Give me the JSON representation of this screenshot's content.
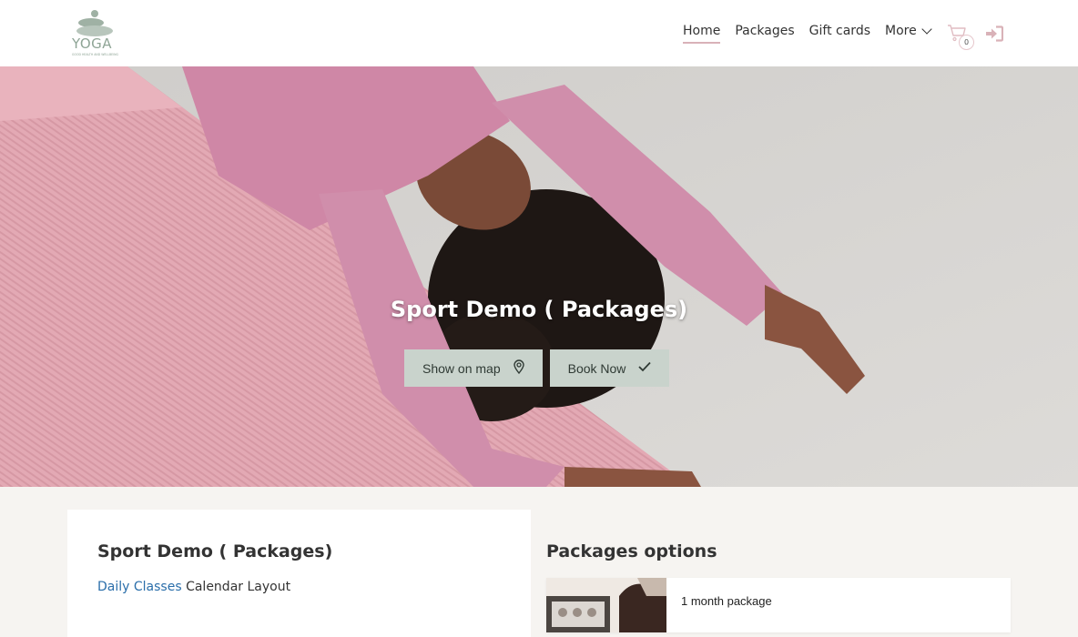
{
  "header": {
    "logo_text": "YOGA",
    "logo_tagline": "GOOD HEALTH AND WELLBEING",
    "nav": [
      {
        "label": "Home",
        "active": true
      },
      {
        "label": "Packages",
        "active": false
      },
      {
        "label": "Gift cards",
        "active": false
      },
      {
        "label": "More",
        "active": false
      }
    ],
    "cart_count": "0",
    "cart_icon": "cart-icon",
    "login_icon": "sign-in-icon"
  },
  "hero": {
    "title": "Sport Demo ( Packages)",
    "show_on_map_label": "Show on map",
    "show_on_map_icon": "map-marker-icon",
    "book_now_label": "Book Now",
    "book_now_icon": "check-icon"
  },
  "info_card": {
    "title": "Sport Demo ( Packages)",
    "link_text": "Daily Classes",
    "line_text": "Calendar Layout"
  },
  "packages": {
    "title": "Packages options",
    "items": [
      {
        "name": "1 month package"
      }
    ]
  },
  "colors": {
    "accent_pink": "#d9b2b8",
    "button_sage": "#c9d3cc",
    "link_blue": "#2a6eaa",
    "page_bg": "#f6f4f1"
  }
}
